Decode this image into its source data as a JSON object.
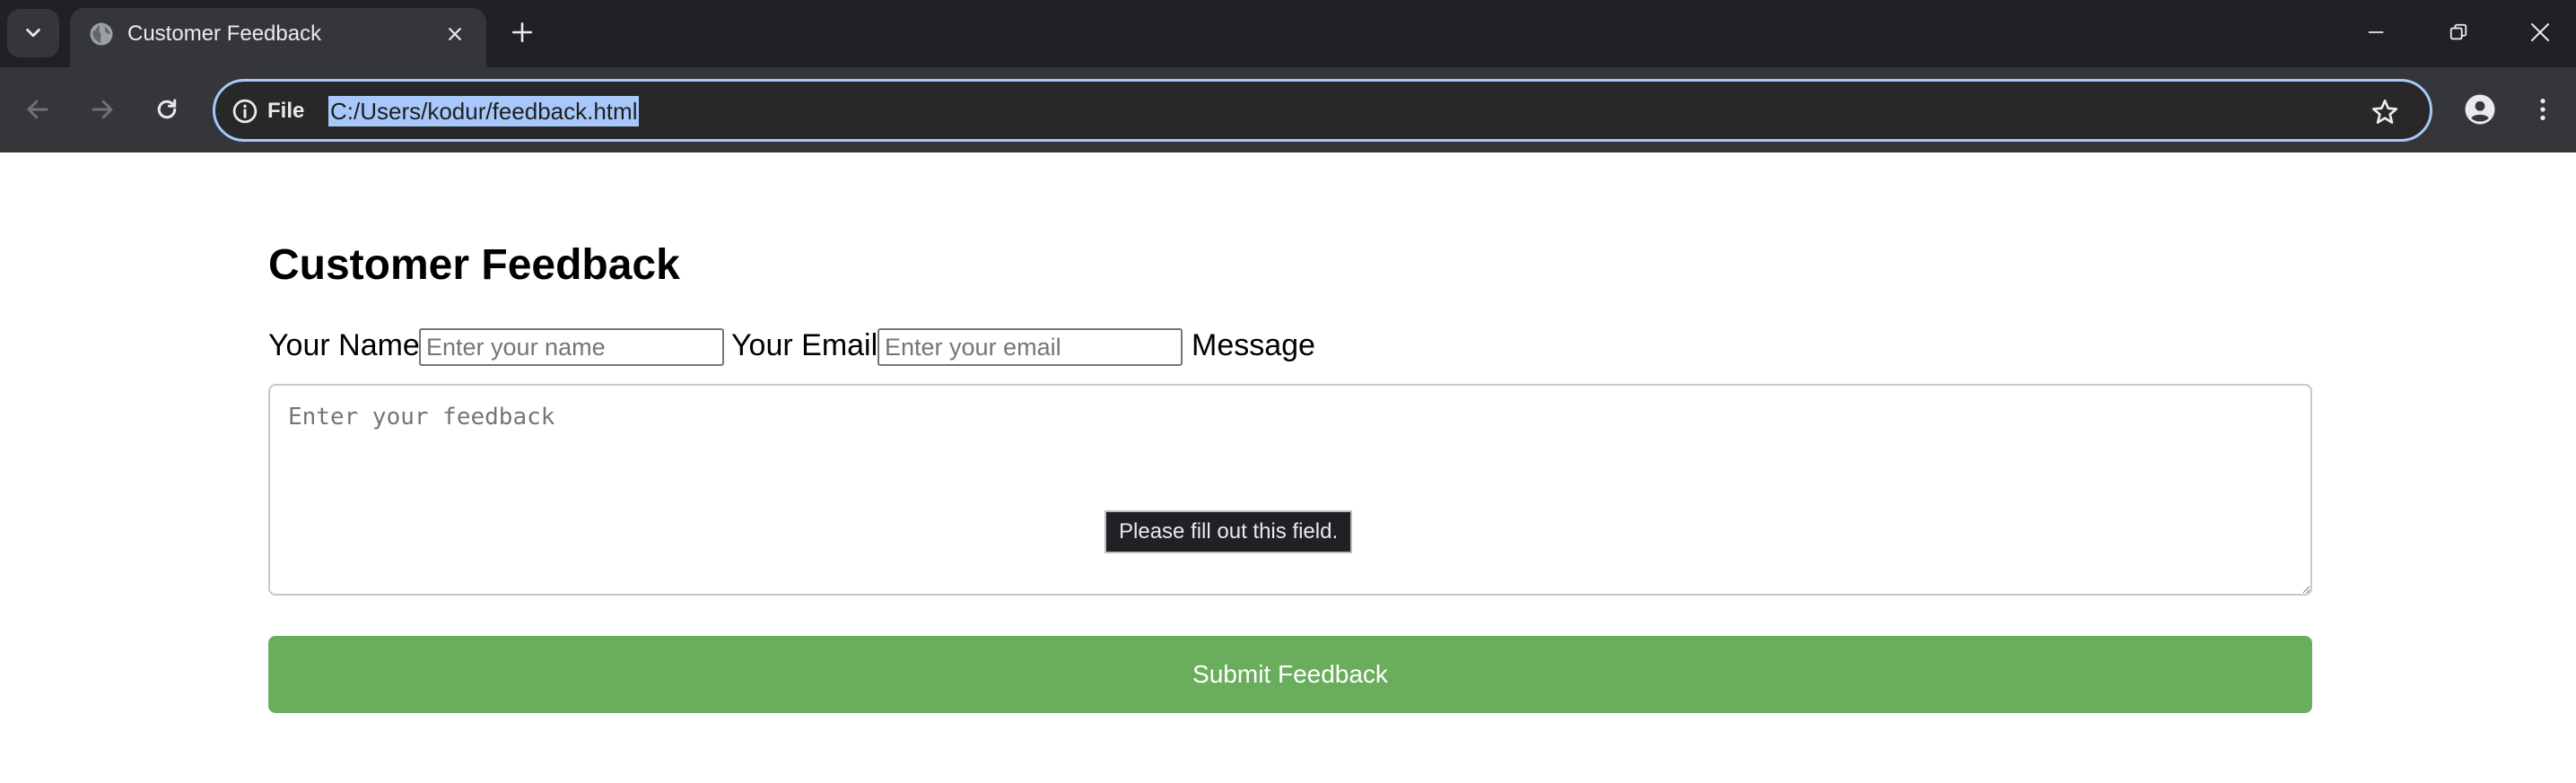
{
  "browser": {
    "tab": {
      "title": "Customer Feedback",
      "favicon": "globe-icon"
    },
    "address_bar": {
      "site_info_label": "File",
      "url": "C:/Users/kodur/feedback.html"
    },
    "icons": {
      "tab_search": "chevron-down-icon",
      "new_tab": "plus-icon",
      "back": "arrow-left-icon",
      "forward": "arrow-right-icon",
      "reload": "reload-icon",
      "site_info": "info-icon",
      "bookmark": "star-icon",
      "profile": "person-icon",
      "menu": "kebab-menu-icon",
      "minimize": "minimize-icon",
      "restore": "restore-icon",
      "close": "close-icon"
    },
    "colors": {
      "tabstrip_bg": "#202124",
      "toolbar_bg": "#35363a",
      "omnibox_border": "#a8c7fa",
      "url_highlight": "#a8c7fa"
    }
  },
  "form": {
    "title": "Customer Feedback",
    "name_label": "Your Name",
    "name_placeholder": "Enter your name",
    "email_label": "Your Email",
    "email_placeholder": "Enter your email",
    "message_label": "Message",
    "message_placeholder": "Enter your feedback",
    "validation_message": "Please fill out this field.",
    "submit_label": "Submit Feedback",
    "colors": {
      "submit_bg": "#6aae5d",
      "submit_text": "#ffffff"
    }
  }
}
